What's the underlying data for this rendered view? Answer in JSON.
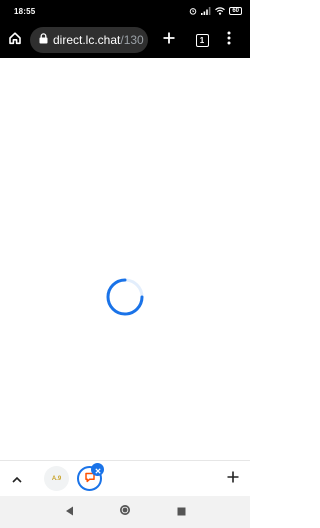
{
  "status_bar": {
    "time": "18:55",
    "battery": "60",
    "icons": [
      "alarm-icon",
      "signal-icon",
      "wifi-icon",
      "battery-icon"
    ]
  },
  "toolbar": {
    "url_host": "direct.lc.chat",
    "url_path": "/130",
    "tab_count": "1",
    "icons": [
      "home-icon",
      "lock-icon",
      "plus-icon",
      "menu-dots-icon"
    ]
  },
  "content": {
    "state": "loading",
    "spinner_color": "#1a73e8"
  },
  "tab_strip": {
    "tab1_favicon_text": "A.9",
    "tab2_favicon": "chat-bubble-icon",
    "accent_color": "#1a73e8",
    "icons": [
      "chevron-up-icon",
      "close-icon",
      "plus-icon"
    ]
  },
  "nav_bar": {
    "icons": [
      "back-triangle-icon",
      "home-circle-icon",
      "recents-square-icon"
    ]
  }
}
